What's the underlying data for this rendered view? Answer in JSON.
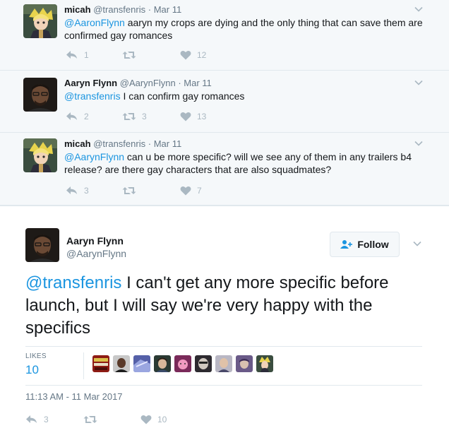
{
  "replies": [
    {
      "name": "micah",
      "handle": "@transfenris",
      "date": "Mar 11",
      "mention": "@AaronFlynn",
      "text": " aaryn my crops are dying and the only thing that can save them are confirmed gay romances",
      "replies": "1",
      "retweets": "",
      "likes": "12"
    },
    {
      "name": "Aaryn Flynn",
      "handle": "@AarynFlynn",
      "date": "Mar 11",
      "mention": "@transfenris",
      "text": " I can confirm gay romances",
      "replies": "2",
      "retweets": "3",
      "likes": "13"
    },
    {
      "name": "micah",
      "handle": "@transfenris",
      "date": "Mar 11",
      "mention": "@AarynFlynn",
      "text": " can u be more specific? will we see any of them in any trailers b4 release? are there gay characters that are also squadmates?",
      "replies": "3",
      "retweets": "",
      "likes": "7"
    }
  ],
  "main_tweet": {
    "name": "Aaryn Flynn",
    "handle": "@AarynFlynn",
    "follow_label": "Follow",
    "mention": "@transfenris",
    "text": " I can't get any more specific before launch, but I will say we're very happy with the specifics",
    "likes_label": "LIKES",
    "likes_count": "10",
    "timestamp": "11:13 AM - 11 Mar 2017",
    "replies": "3",
    "retweets": "",
    "likes": "10"
  },
  "colors": {
    "link": "#1b95e0",
    "muted": "#657786",
    "icon": "#aab8c2",
    "thread_bg": "#f5f8fa"
  },
  "icons": {
    "reply": "reply-icon",
    "retweet": "retweet-icon",
    "like": "heart-icon",
    "caret": "chevron-down-icon",
    "follow": "add-user-icon"
  }
}
